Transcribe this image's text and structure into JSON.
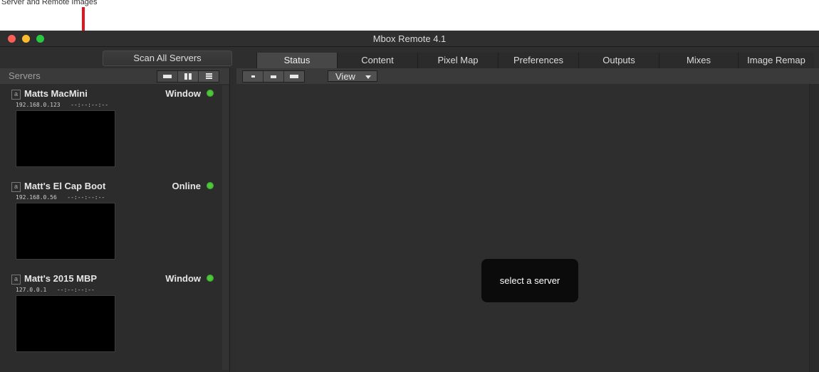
{
  "annotation": {
    "caption": "Server and Remote Images"
  },
  "window": {
    "title": "Mbox Remote 4.1"
  },
  "toolbar": {
    "scan_label": "Scan All Servers",
    "tabs": [
      {
        "label": "Status",
        "active": true
      },
      {
        "label": "Content",
        "active": false
      },
      {
        "label": "Pixel Map",
        "active": false
      },
      {
        "label": "Preferences",
        "active": false
      },
      {
        "label": "Outputs",
        "active": false
      },
      {
        "label": "Mixes",
        "active": false
      },
      {
        "label": "Image Remap",
        "active": false
      }
    ]
  },
  "sidebar": {
    "title": "Servers",
    "view_modes": [
      "large-thumbnail",
      "grid",
      "list"
    ],
    "servers": [
      {
        "icon_letter": "a",
        "name": "Matts MacMini",
        "status": "Window",
        "ip": "192.168.0.123",
        "timecode": "--:--:--:--",
        "status_color": "#4ec93a"
      },
      {
        "icon_letter": "a",
        "name": "Matt's El Cap Boot",
        "status": "Online",
        "ip": "192.168.0.56",
        "timecode": "--:--:--:--",
        "status_color": "#4ec93a"
      },
      {
        "icon_letter": "a",
        "name": "Matt's 2015 MBP",
        "status": "Window",
        "ip": "127.0.0.1",
        "timecode": "--:--:--:--",
        "status_color": "#4ec93a"
      }
    ]
  },
  "main": {
    "size_buttons": [
      "small",
      "medium",
      "large"
    ],
    "view_label": "View",
    "message": "select a server"
  },
  "colors": {
    "annotation_arrow": "#e0161c",
    "status_online": "#4ec93a"
  }
}
